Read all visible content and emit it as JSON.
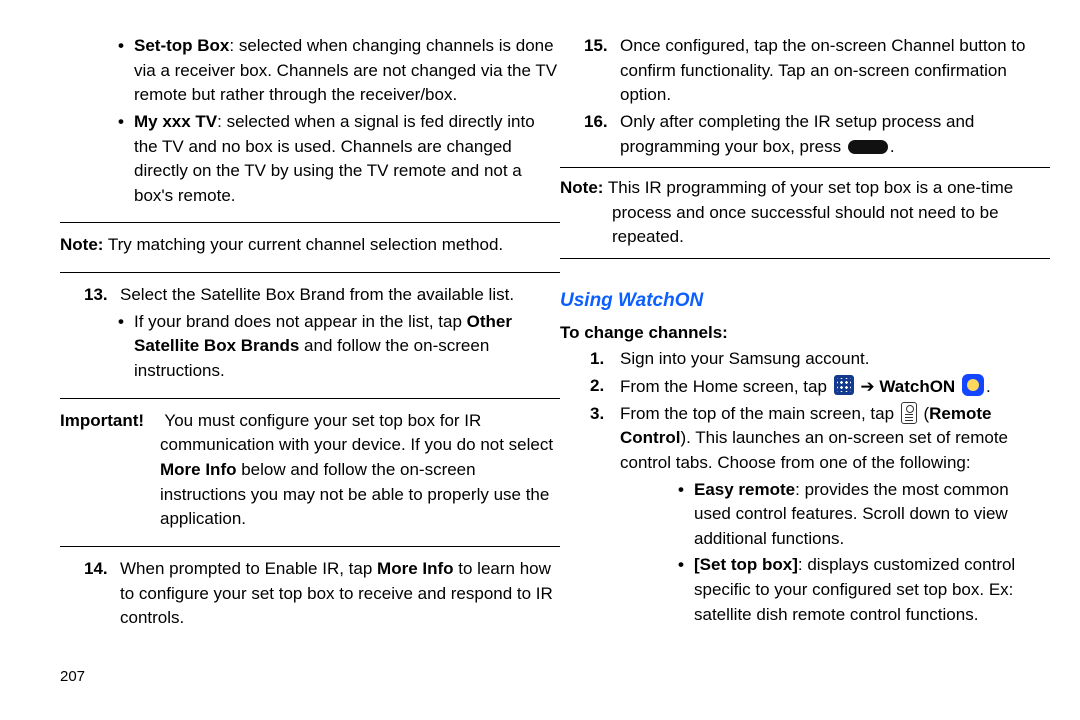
{
  "left": {
    "bullet_items": [
      {
        "lead": "Set-top Box",
        "rest": ": selected when changing channels is done via a receiver box. Channels are not changed via the TV remote but rather through the receiver/box."
      },
      {
        "lead": "My xxx TV",
        "rest": ": selected when a signal is fed directly into the TV and no box is used. Channels are changed directly on the TV by using the TV remote and not a box's remote."
      }
    ],
    "note1_label": "Note:",
    "note1_text": " Try matching your current channel selection method.",
    "step13_num": "13.",
    "step13_text": "Select the Satellite Box Brand from the available list.",
    "step13_sub_pre": "If your brand does not appear in the list, tap ",
    "step13_sub_bold": "Other Satellite Box Brands",
    "step13_sub_post": " and follow the on-screen instructions.",
    "imp_label": "Important!",
    "imp_text": " You must configure your set top box for IR communication with your device. If you do not select ",
    "imp_bold": "More Info",
    "imp_text2": " below and follow the on-screen instructions you may not be able to properly use the application.",
    "step14_num": "14.",
    "step14_pre": "When prompted to Enable IR, tap ",
    "step14_bold": "More Info",
    "step14_post": " to learn how to configure your set top box to receive and respond to IR controls."
  },
  "right": {
    "step15_num": "15.",
    "step15_text": "Once configured, tap the on-screen Channel button to confirm functionality. Tap an on-screen confirmation option.",
    "step16_num": "16.",
    "step16_pre": "Only after completing the IR setup process and programming your box, press ",
    "step16_post": ".",
    "note2_label": "Note:",
    "note2_text": " This IR programming of your set top box is a one-time process and once successful should not need to be repeated.",
    "section": "Using WatchON",
    "subhd": "To change channels:",
    "r1_num": "1.",
    "r1_text": "Sign into your Samsung account.",
    "r2_num": "2.",
    "r2_pre": "From the Home screen, tap ",
    "r2_mid": " ➔ ",
    "r2_bold": "WatchON",
    "r2_post": ".",
    "r3_num": "3.",
    "r3_pre": "From the top of the main screen, tap ",
    "r3_paren_open": " (",
    "r3_bold": "Remote Control",
    "r3_paren_close": "). This launches an on-screen set of remote control tabs. Choose from one of the following:",
    "r3_sub1_lead": "Easy remote",
    "r3_sub1_rest": ": provides the most common used control features. Scroll down to view additional functions.",
    "r3_sub2_lead": "[Set top box]",
    "r3_sub2_rest": ": displays customized control specific to your configured set top box. Ex: satellite dish remote control functions."
  },
  "page_number": "207"
}
